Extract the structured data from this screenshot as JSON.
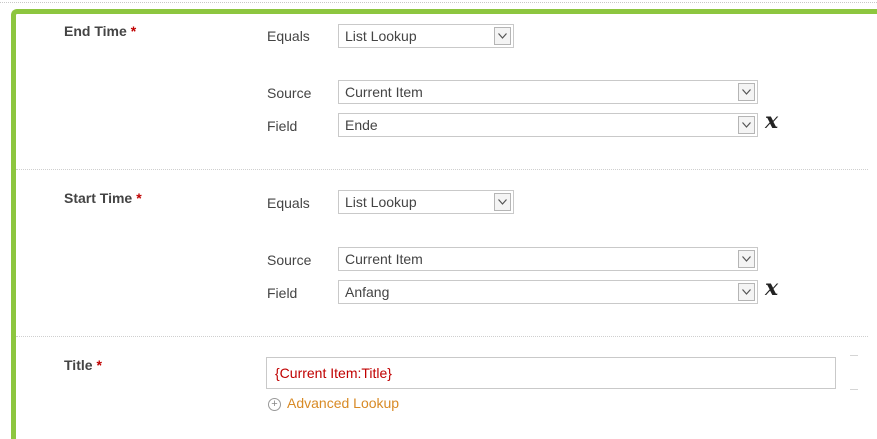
{
  "sections": [
    {
      "label": "End Time",
      "required_marker": "*",
      "equals_label": "Equals",
      "equals_value": "List Lookup",
      "source_label": "Source",
      "source_value": "Current Item",
      "field_label": "Field",
      "field_value": "Ende",
      "remove_icon": "x"
    },
    {
      "label": "Start Time",
      "required_marker": "*",
      "equals_label": "Equals",
      "equals_value": "List Lookup",
      "source_label": "Source",
      "source_value": "Current Item",
      "field_label": "Field",
      "field_value": "Anfang",
      "remove_icon": "x"
    }
  ],
  "title_field": {
    "label": "Title",
    "required_marker": "*",
    "value": "{Current Item:Title}",
    "advanced_lookup_label": "Advanced Lookup",
    "advanced_lookup_icon": "⊕"
  },
  "colors": {
    "accent_border": "#8dc63f",
    "required": "#c00000",
    "link": "#d88a25"
  }
}
